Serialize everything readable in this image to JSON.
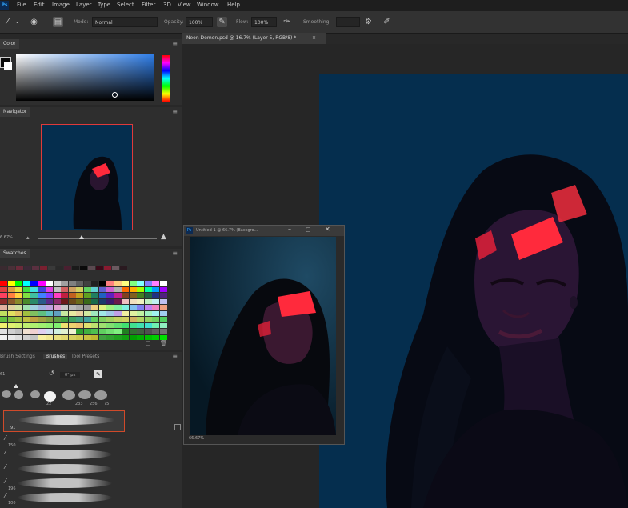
{
  "app": {
    "logo": "Ps"
  },
  "menu": [
    "File",
    "Edit",
    "Image",
    "Layer",
    "Type",
    "Select",
    "Filter",
    "3D",
    "View",
    "Window",
    "Help"
  ],
  "options": {
    "mode_label": "Mode:",
    "mode_value": "Normal",
    "opacity_label": "Opacity:",
    "opacity_value": "100%",
    "flow_label": "Flow:",
    "flow_value": "100%",
    "smoothing_label": "Smoothing:"
  },
  "color_panel": {
    "tab": "Color"
  },
  "navigator": {
    "tab": "Navigator",
    "zoom": "6.67%"
  },
  "swatches": {
    "tab": "Swatches"
  },
  "brushes": {
    "tabs": [
      "Brush Settings",
      "Brushes",
      "Tool Presets"
    ],
    "size_value": "61",
    "angle_value": "0° px",
    "tip_sizes": [
      "",
      "",
      "",
      "22",
      "",
      "233",
      "256",
      "75"
    ],
    "list_sizes": [
      "91",
      "",
      "150",
      "",
      "",
      "196",
      "100"
    ]
  },
  "document": {
    "tab_title": "Neon Demon.psd @ 16.7% (Layer 5, RGB/8) *"
  },
  "float_window": {
    "title": "Untitled-1 @ 66.7% (Backgro...",
    "zoom": "66.67%"
  },
  "colors": {
    "canvas_bg": "#052e4e",
    "accent_red": "#ff2a3c",
    "panel_bg": "#2e2e2e"
  }
}
